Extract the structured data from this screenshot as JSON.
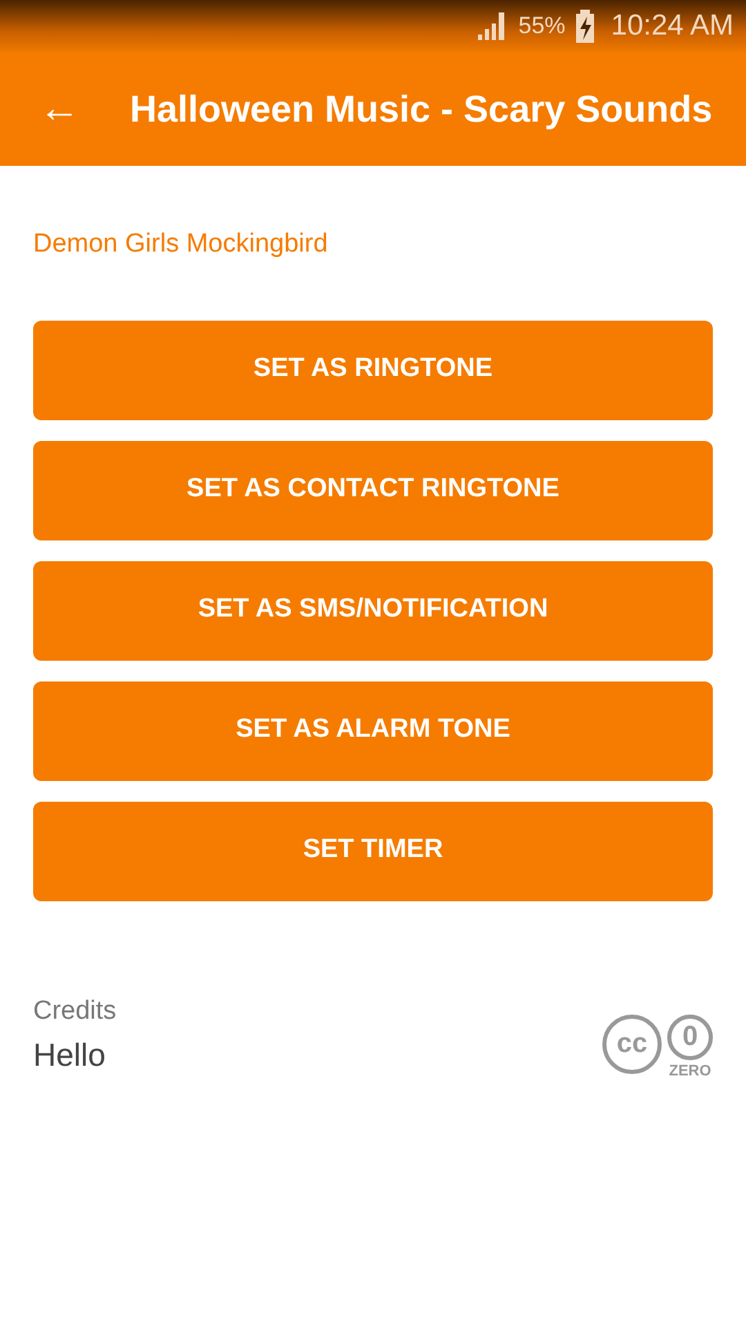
{
  "status_bar": {
    "battery": "55%",
    "time": "10:24 AM"
  },
  "app_bar": {
    "back": "←",
    "title": "Halloween Music - Scary Sounds"
  },
  "sound_name": "Demon Girls Mockingbird",
  "buttons": [
    "SET AS RINGTONE",
    "SET AS CONTACT RINGTONE",
    "SET AS SMS/NOTIFICATION",
    "SET AS ALARM TONE",
    "SET TIMER"
  ],
  "credits": {
    "label": "Credits",
    "text": "Hello"
  },
  "license": {
    "cc": "cc",
    "zero_digit": "0",
    "zero_label": "ZERO"
  }
}
